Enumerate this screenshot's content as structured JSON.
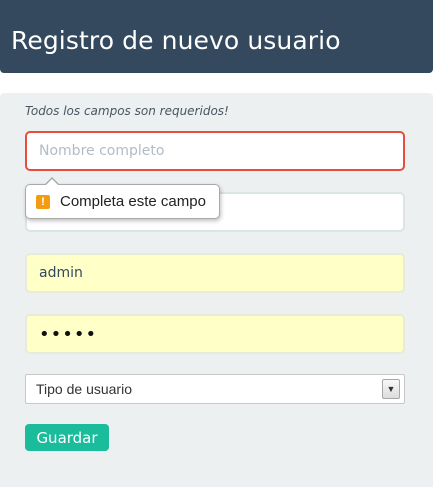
{
  "header": {
    "title": "Registro de nuevo usuario"
  },
  "form": {
    "hint": "Todos los campos son requeridos!",
    "fullname": {
      "placeholder": "Nombre completo",
      "value": ""
    },
    "email": {
      "placeholder": "",
      "value": ""
    },
    "username": {
      "value": "admin"
    },
    "password": {
      "value": "•••••"
    },
    "user_type": {
      "selected": "Tipo de usuario"
    },
    "submit_label": "Guardar"
  },
  "validation": {
    "message": "Completa este campo",
    "icon": "warning-icon"
  },
  "colors": {
    "header_bg": "#34495e",
    "panel_bg": "#ecf0f1",
    "accent": "#1abc9c",
    "error": "#e74c3c",
    "autofill": "#ffffc8"
  }
}
